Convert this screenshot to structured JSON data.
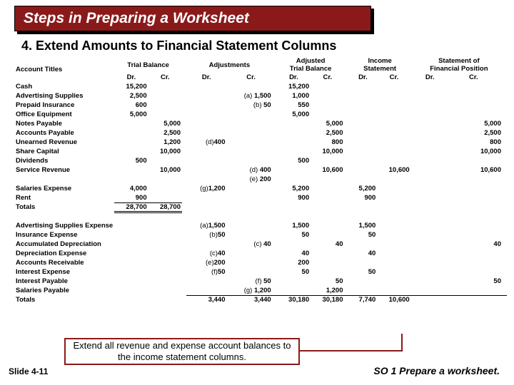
{
  "banner_title": "Steps in Preparing a Worksheet",
  "subhead": "4. Extend Amounts to Financial Statement Columns",
  "col_groups": [
    "Trial Balance",
    "Adjustments",
    "Adjusted Trial Balance",
    "Income Statement",
    "Statement of Financial Position"
  ],
  "drcr": [
    "Dr.",
    "Cr."
  ],
  "acct_header": "Account Titles",
  "rows": [
    {
      "a": "Cash",
      "tb_d": "15,200",
      "atb_d": "15,200"
    },
    {
      "a": "Advertising Supplies",
      "tb_d": "2,500",
      "adj_c_l": "(a)",
      "adj_c": "1,500",
      "atb_d": "1,000"
    },
    {
      "a": "Prepaid Insurance",
      "tb_d": "600",
      "adj_c_l": "(b)",
      "adj_c": "50",
      "atb_d": "550"
    },
    {
      "a": "Office Equipment",
      "tb_d": "5,000",
      "atb_d": "5,000"
    },
    {
      "a": "Notes Payable",
      "tb_c": "5,000",
      "atb_c": "5,000",
      "fp_c": "5,000"
    },
    {
      "a": "Accounts Payable",
      "tb_c": "2,500",
      "atb_c": "2,500",
      "fp_c": "2,500"
    },
    {
      "a": "Unearned Revenue",
      "tb_c": "1,200",
      "adj_d_l": "(d)",
      "adj_d": "400",
      "atb_c": "800",
      "fp_c": "800"
    },
    {
      "a": "Share Capital",
      "tb_c": "10,000",
      "atb_c": "10,000",
      "fp_c": "10,000"
    },
    {
      "a": "Dividends",
      "tb_d": "500",
      "atb_d": "500"
    },
    {
      "a": "Service Revenue",
      "tb_c": "10,000",
      "adj_c_l": "(d)",
      "adj_c": "400",
      "atb_c": "10,600",
      "is_c": "10,600",
      "fp_c": "10,600"
    },
    {
      "a": "",
      "adj_c_l": "(e)",
      "adj_c": "200"
    },
    {
      "a": "Salaries Expense",
      "tb_d": "4,000",
      "adj_d_l": "(g)",
      "adj_d": "1,200",
      "atb_d": "5,200",
      "is_d": "5,200"
    },
    {
      "a": "Rent",
      "tb_d": "900",
      "atb_d": "900",
      "is_d": "900"
    },
    {
      "a": "Totals",
      "tb_d": "28,700",
      "tb_c": "28,700",
      "totals1": true
    },
    {
      "a": "Advertising Supplies Expense",
      "adj_d_l": "(a)",
      "adj_d": "1,500",
      "atb_d": "1,500",
      "is_d": "1,500"
    },
    {
      "a": "Insurance Expense",
      "adj_d_l": "(b)",
      "adj_d": "50",
      "atb_d": "50",
      "is_d": "50"
    },
    {
      "a": "Accumulated Depreciation",
      "adj_c_l": "(c)",
      "adj_c": "40",
      "atb_c": "40",
      "fp_c": "40"
    },
    {
      "a": "Depreciation Expense",
      "adj_d_l": "(c)",
      "adj_d": "40",
      "atb_d": "40",
      "is_d": "40"
    },
    {
      "a": "Accounts Receivable",
      "adj_d_l": "(e)",
      "adj_d": "200",
      "atb_d": "200"
    },
    {
      "a": "Interest Expense",
      "adj_d_l": "(f)",
      "adj_d": "50",
      "atb_d": "50",
      "is_d": "50"
    },
    {
      "a": "Interest Payable",
      "adj_c_l": "(f)",
      "adj_c": "50",
      "atb_c": "50",
      "fp_c": "50"
    },
    {
      "a": "Salaries Payable",
      "adj_c_l": "(g)",
      "adj_c": "1,200",
      "atb_c": "1,200"
    },
    {
      "a": "Totals",
      "adj_d": "3,440",
      "adj_c": "3,440",
      "atb_d": "30,180",
      "atb_c": "30,180",
      "is_d": "7,740",
      "is_c": "10,600",
      "totals2": true
    }
  ],
  "callout_text": "Extend all revenue and expense account balances to the income statement columns.",
  "slide_num": "Slide 4-11",
  "footer_right": "SO 1  Prepare a worksheet."
}
